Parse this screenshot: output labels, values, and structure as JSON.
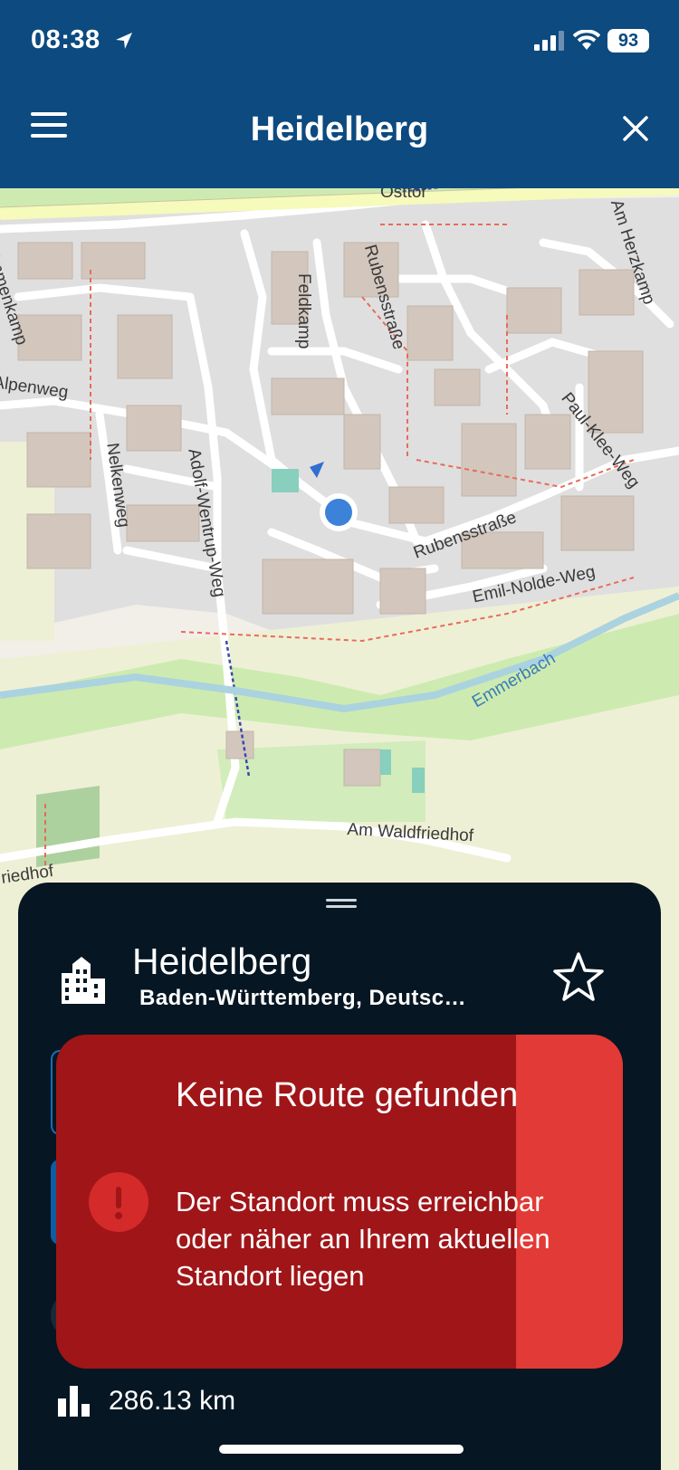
{
  "status": {
    "time": "08:38",
    "battery": "93"
  },
  "header": {
    "title": "Heidelberg"
  },
  "map": {
    "streets": [
      "Osttor",
      "Rubensstraße",
      "Am Herzkamp",
      "Immenkamp",
      "Feldkamp",
      "Alpenweg",
      "Paul-Klee-Weg",
      "Nelkenweg",
      "Adolf-Wentrup-Weg",
      "Rubensstraße",
      "Emil-Nolde-Weg",
      "Emil-Nolde-Weg",
      "Am Waldfriedhof",
      "riedhof"
    ],
    "waterway": "Emmerbach"
  },
  "sheet": {
    "title": "Heidelberg",
    "subtitle": "Baden-Württemberg,  Deutsc…",
    "distance": "286.13 km"
  },
  "toast": {
    "title": "Keine Route gefunden",
    "message": "Der Standort muss erreichbar oder näher an Ihrem aktuellen Standort liegen"
  },
  "colors": {
    "header": "#0c4a7f",
    "sheet": "#061623",
    "toast": "#a01518",
    "toast_accent": "#e23a36",
    "location_dot": "#3b82d8"
  }
}
